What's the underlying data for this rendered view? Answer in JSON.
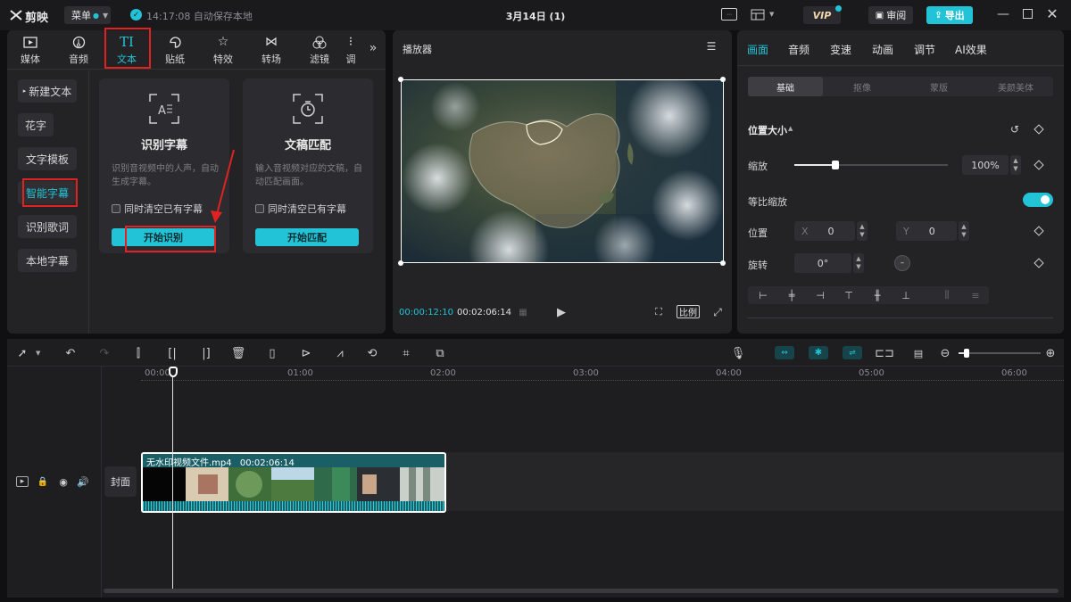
{
  "app": {
    "logo": "剪映",
    "menu_label": "菜单",
    "save_status": "14:17:08 自动保存本地",
    "project_title": "3月14日 (1)",
    "vip_label": "VIP",
    "review_label": "审阅",
    "export_label": "导出"
  },
  "toolbar_tabs": [
    {
      "label": "媒体",
      "icon": "media-icon"
    },
    {
      "label": "音频",
      "icon": "audio-icon"
    },
    {
      "label": "文本",
      "icon": "text-icon"
    },
    {
      "label": "贴纸",
      "icon": "sticker-icon"
    },
    {
      "label": "特效",
      "icon": "effects-icon"
    },
    {
      "label": "转场",
      "icon": "transition-icon"
    },
    {
      "label": "滤镜",
      "icon": "filter-icon"
    },
    {
      "label": "调",
      "icon": "adjust-icon"
    }
  ],
  "text_sidebar": [
    {
      "label": "新建文本"
    },
    {
      "label": "花字"
    },
    {
      "label": "文字模板"
    },
    {
      "label": "智能字幕"
    },
    {
      "label": "识别歌词"
    },
    {
      "label": "本地字幕"
    }
  ],
  "cards": {
    "recognize": {
      "title": "识别字幕",
      "desc": "识别音视频中的人声，自动生成字幕。",
      "checkbox": "同时清空已有字幕",
      "button": "开始识别"
    },
    "match": {
      "title": "文稿匹配",
      "desc": "输入音视频对应的文稿，自动匹配画面。",
      "checkbox": "同时清空已有字幕",
      "button": "开始匹配"
    }
  },
  "player": {
    "title": "播放器",
    "current_time": "00:00:12:10",
    "total_time": "00:02:06:14",
    "ratio_label": "比例"
  },
  "props": {
    "tabs": [
      "画面",
      "音频",
      "变速",
      "动画",
      "调节",
      "AI效果"
    ],
    "subtabs": [
      "基础",
      "抠像",
      "蒙版",
      "美颜美体"
    ],
    "section": "位置大小",
    "scale_label": "缩放",
    "scale_value": "100%",
    "scale_fraction": 0.27,
    "uniform_label": "等比缩放",
    "uniform_on": true,
    "position_label": "位置",
    "x_label": "X",
    "x_value": "0",
    "y_label": "Y",
    "y_value": "0",
    "rotation_label": "旋转",
    "rotation_value": "0°"
  },
  "timeline": {
    "ruler": [
      "00:00",
      "01:00",
      "02:00",
      "03:00",
      "04:00",
      "05:00",
      "06:00"
    ],
    "cover_label": "封面",
    "clip_name": "无水印视频文件.mp4",
    "clip_duration": "00:02:06:14"
  },
  "colors": {
    "accent": "#22c3d6",
    "highlight_red": "#e02222",
    "clip_bg": "#1a5f66"
  }
}
